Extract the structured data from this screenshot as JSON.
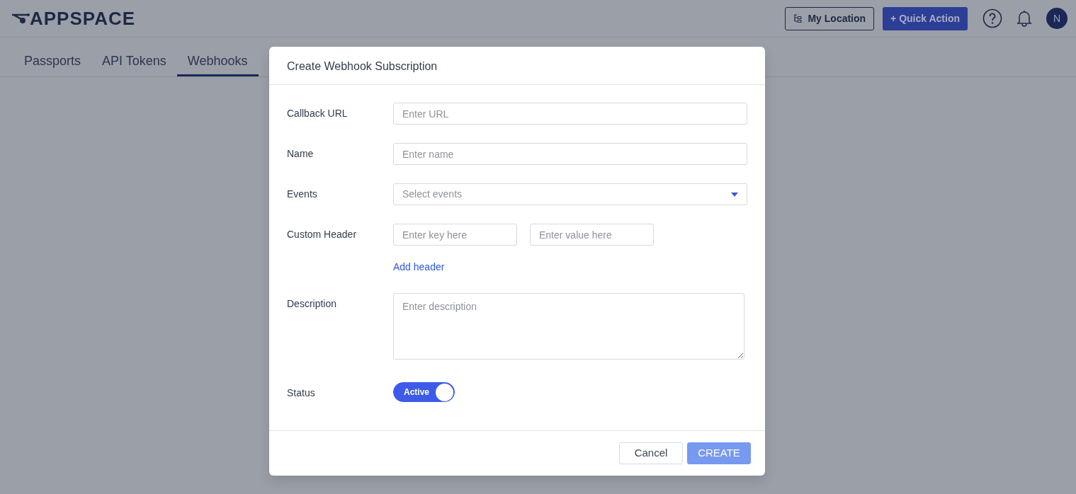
{
  "header": {
    "logo": "APPSPACE",
    "location_button": "My Location",
    "quick_action_button": "+ Quick Action",
    "avatar": "N"
  },
  "tabs": [
    {
      "label": "Passports",
      "selected": false
    },
    {
      "label": "API Tokens",
      "selected": false
    },
    {
      "label": "Webhooks",
      "selected": true
    }
  ],
  "dialog": {
    "title": "Create Webhook Subscription",
    "fields": [
      {
        "kind": "text",
        "label": "Callback URL",
        "placeholder": "Enter URL"
      },
      {
        "kind": "text",
        "label": "Name",
        "placeholder": "Enter name"
      },
      {
        "kind": "select",
        "label": "Events",
        "placeholder": "Select events"
      },
      {
        "kind": "pair",
        "label": "Custom Header",
        "key_placeholder": "Enter key here",
        "value_placeholder": "Enter value here",
        "link": "Add header"
      },
      {
        "kind": "textarea",
        "label": "Description",
        "placeholder": "Enter description"
      },
      {
        "kind": "toggle",
        "label": "Status",
        "text": "Active",
        "on": true
      }
    ],
    "buttons": [
      {
        "label": "Cancel",
        "kind": "secondary",
        "disabled": false
      },
      {
        "label": "CREATE",
        "kind": "primary",
        "disabled": true
      }
    ]
  }
}
